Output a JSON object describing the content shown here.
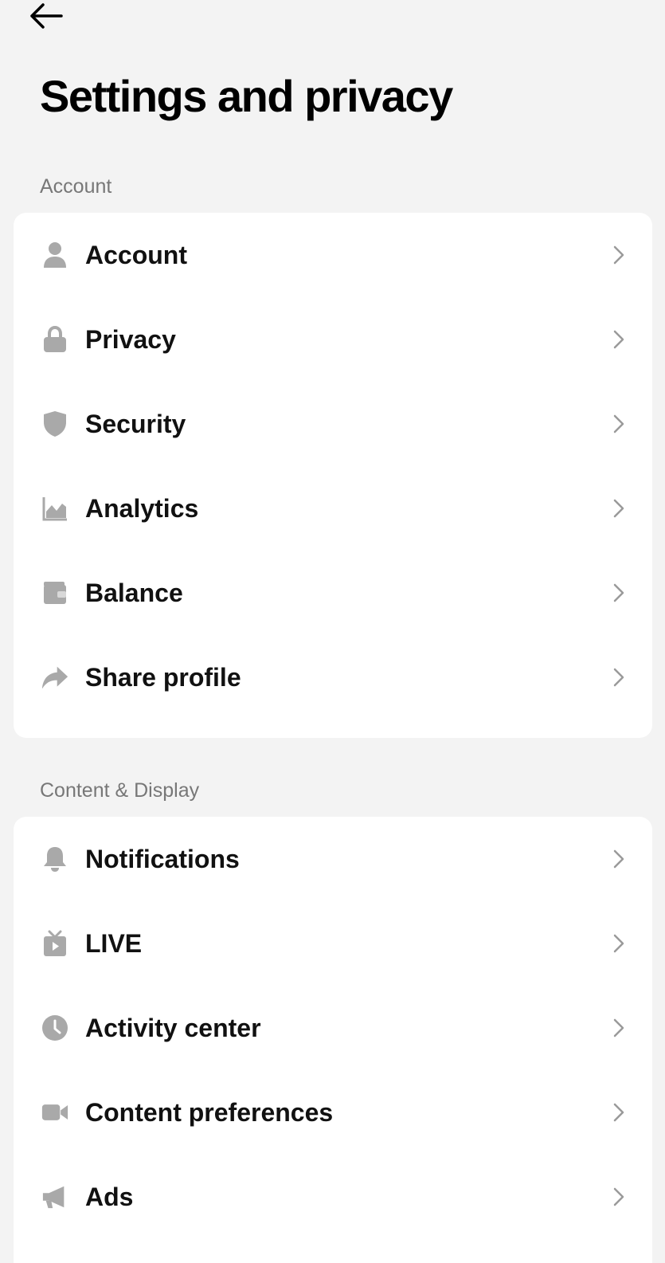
{
  "header": {
    "title": "Settings and privacy"
  },
  "sections": [
    {
      "header": "Account",
      "items": [
        {
          "label": "Account",
          "icon": "person-icon"
        },
        {
          "label": "Privacy",
          "icon": "lock-icon"
        },
        {
          "label": "Security",
          "icon": "shield-icon"
        },
        {
          "label": "Analytics",
          "icon": "chart-icon"
        },
        {
          "label": "Balance",
          "icon": "wallet-icon"
        },
        {
          "label": "Share profile",
          "icon": "share-icon"
        }
      ]
    },
    {
      "header": "Content & Display",
      "items": [
        {
          "label": "Notifications",
          "icon": "bell-icon"
        },
        {
          "label": "LIVE",
          "icon": "tv-icon"
        },
        {
          "label": "Activity center",
          "icon": "clock-icon"
        },
        {
          "label": "Content preferences",
          "icon": "video-camera-icon"
        },
        {
          "label": "Ads",
          "icon": "megaphone-icon"
        }
      ]
    }
  ],
  "colors": {
    "background": "#f3f3f3",
    "card": "#ffffff",
    "icon_gray": "#a9a9a9",
    "chevron_gray": "#9a9a9a",
    "section_header": "#777777"
  }
}
